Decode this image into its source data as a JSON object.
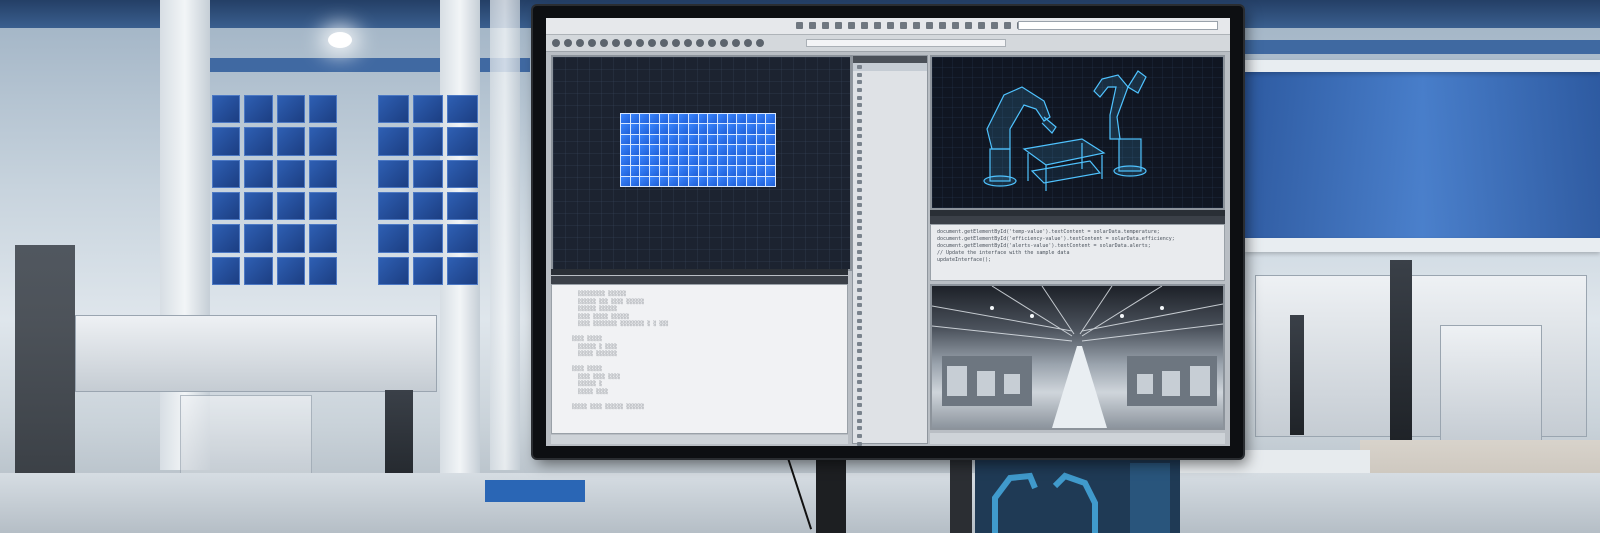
{
  "scene": {
    "description_free": true
  },
  "monitor": {
    "outliner": {
      "items": [
        "",
        "",
        "",
        "",
        "",
        "",
        "",
        "",
        "",
        "",
        "",
        "",
        "",
        "",
        "",
        "",
        "",
        "",
        "",
        "",
        "",
        "",
        "",
        "",
        "",
        "",
        "",
        "",
        "",
        "",
        "",
        "",
        "",
        "",
        "",
        "",
        "",
        "",
        "",
        "",
        "",
        "",
        "",
        "",
        "",
        "",
        "",
        "",
        "",
        ""
      ]
    },
    "code_panel": {
      "lines": [
        "document.getElementById('temp-value').textContent = solarData.temperature;",
        "document.getElementById('efficiency-value').textContent = solarData.efficiency;",
        "document.getElementById('alerts-value').textContent = solarData.alerts;",
        "",
        "// Update the interface with the sample data",
        "updateInterface();"
      ]
    }
  },
  "colors": {
    "accent_blue": "#3a86ff",
    "robot_cyan": "#4fc3ff"
  }
}
